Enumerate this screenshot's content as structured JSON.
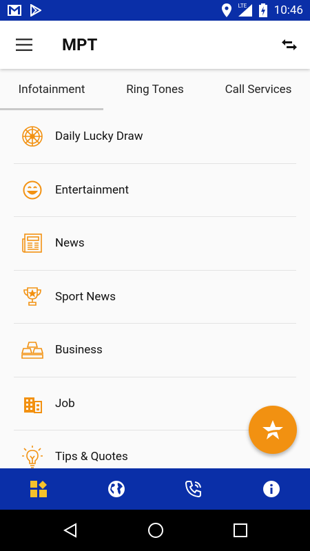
{
  "status_bar": {
    "time": "10:46",
    "network": "LTE",
    "icons": [
      "gmail-icon",
      "play-store-icon",
      "location-icon",
      "signal-icon",
      "battery-icon"
    ]
  },
  "app_bar": {
    "title": "MPT",
    "menu_icon": "hamburger-menu-icon",
    "action_icon": "swap-arrows-icon"
  },
  "tabs": [
    {
      "label": "Infotainment",
      "active": true
    },
    {
      "label": "Ring Tones",
      "active": false
    },
    {
      "label": "Call Services",
      "active": false
    }
  ],
  "list": {
    "items": [
      {
        "label": "Daily Lucky Draw",
        "icon": "lucky-wheel-icon"
      },
      {
        "label": "Entertainment",
        "icon": "smiley-icon"
      },
      {
        "label": "News",
        "icon": "newspaper-icon"
      },
      {
        "label": "Sport News",
        "icon": "trophy-icon"
      },
      {
        "label": "Business",
        "icon": "gold-bars-icon"
      },
      {
        "label": "Job",
        "icon": "office-building-icon"
      },
      {
        "label": "Tips & Quotes",
        "icon": "lightbulb-icon"
      }
    ]
  },
  "fab": {
    "icon": "star-icon"
  },
  "bottom_nav": {
    "items": [
      {
        "icon": "dashboard-icon",
        "active": true
      },
      {
        "icon": "globe-icon",
        "active": false
      },
      {
        "icon": "phone-call-icon",
        "active": false
      },
      {
        "icon": "info-icon",
        "active": false
      }
    ]
  },
  "colors": {
    "primary": "#0a2fa8",
    "accent": "#f29111",
    "active_nav": "#f6c22b"
  }
}
